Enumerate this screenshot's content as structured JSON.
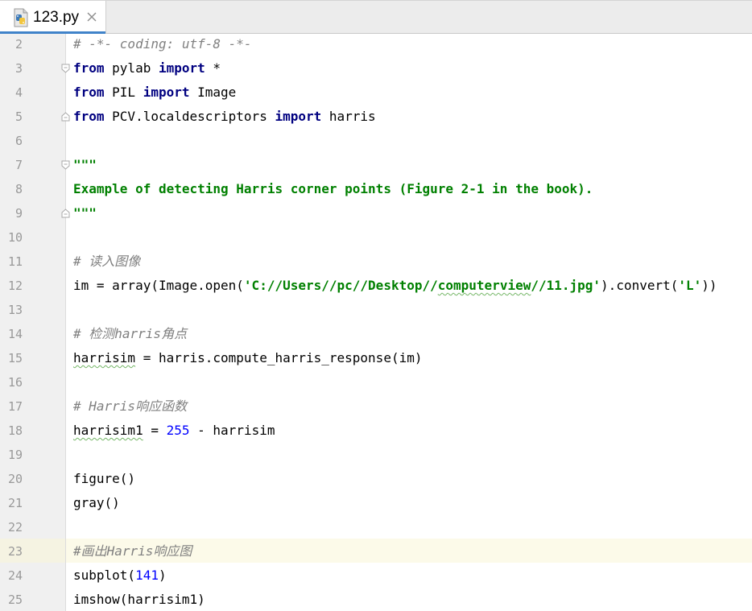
{
  "tab": {
    "title": "123.py",
    "icon": "python-file-icon",
    "close_icon": "close-icon"
  },
  "colors": {
    "keyword": "#000080",
    "comment": "#808080",
    "docstring": "#008000",
    "number": "#0000ff",
    "caret_row": "#fcfae9",
    "tab_underline": "#4083c9"
  },
  "lines": [
    {
      "num": "2",
      "tokens": [
        {
          "t": "# -*- coding: utf-8 -*-",
          "c": "cm"
        }
      ]
    },
    {
      "num": "3",
      "tokens": [
        {
          "t": "from",
          "c": "kw"
        },
        {
          "t": " pylab ",
          "c": ""
        },
        {
          "t": "import",
          "c": "kw"
        },
        {
          "t": " *",
          "c": ""
        }
      ]
    },
    {
      "num": "4",
      "tokens": [
        {
          "t": "from",
          "c": "kw"
        },
        {
          "t": " PIL ",
          "c": ""
        },
        {
          "t": "import",
          "c": "kw"
        },
        {
          "t": " Image",
          "c": ""
        }
      ]
    },
    {
      "num": "5",
      "tokens": [
        {
          "t": "from",
          "c": "kw"
        },
        {
          "t": " PCV.localdescriptors ",
          "c": ""
        },
        {
          "t": "import",
          "c": "kw"
        },
        {
          "t": " harris",
          "c": ""
        }
      ]
    },
    {
      "num": "6",
      "tokens": []
    },
    {
      "num": "7",
      "tokens": [
        {
          "t": "\"\"\"",
          "c": "ds"
        }
      ]
    },
    {
      "num": "8",
      "tokens": [
        {
          "t": "Example of detecting Harris corner points (Figure 2-1 in the book).",
          "c": "ds"
        }
      ]
    },
    {
      "num": "9",
      "tokens": [
        {
          "t": "\"\"\"",
          "c": "ds"
        }
      ]
    },
    {
      "num": "10",
      "tokens": []
    },
    {
      "num": "11",
      "tokens": [
        {
          "t": "# 读入图像",
          "c": "cm"
        }
      ]
    },
    {
      "num": "12",
      "tokens": [
        {
          "t": "im = array(Image.open(",
          "c": ""
        },
        {
          "t": "'C://Users//pc//Desktop//",
          "c": "str"
        },
        {
          "t": "computerview",
          "c": "str spell"
        },
        {
          "t": "//11.jpg'",
          "c": "str"
        },
        {
          "t": ").convert(",
          "c": ""
        },
        {
          "t": "'L'",
          "c": "str"
        },
        {
          "t": "))",
          "c": ""
        }
      ]
    },
    {
      "num": "13",
      "tokens": []
    },
    {
      "num": "14",
      "tokens": [
        {
          "t": "# 检测harris角点",
          "c": "cm"
        }
      ]
    },
    {
      "num": "15",
      "tokens": [
        {
          "t": "harrisim",
          "c": "spell"
        },
        {
          "t": " = harris.compute_harris_response(im)",
          "c": ""
        }
      ]
    },
    {
      "num": "16",
      "tokens": []
    },
    {
      "num": "17",
      "tokens": [
        {
          "t": "# Harris响应函数",
          "c": "cm"
        }
      ]
    },
    {
      "num": "18",
      "tokens": [
        {
          "t": "harrisim1",
          "c": "spell"
        },
        {
          "t": " = ",
          "c": ""
        },
        {
          "t": "255",
          "c": "num"
        },
        {
          "t": " - harrisim",
          "c": ""
        }
      ]
    },
    {
      "num": "19",
      "tokens": []
    },
    {
      "num": "20",
      "tokens": [
        {
          "t": "figure()",
          "c": ""
        }
      ]
    },
    {
      "num": "21",
      "tokens": [
        {
          "t": "gray()",
          "c": ""
        }
      ]
    },
    {
      "num": "22",
      "tokens": []
    },
    {
      "num": "23",
      "tokens": [
        {
          "t": "#画出Harris响应图",
          "c": "cm"
        }
      ]
    },
    {
      "num": "24",
      "tokens": [
        {
          "t": "subplot(",
          "c": ""
        },
        {
          "t": "141",
          "c": "num"
        },
        {
          "t": ")",
          "c": ""
        }
      ]
    },
    {
      "num": "25",
      "tokens": [
        {
          "t": "imshow(harrisim1)",
          "c": ""
        }
      ]
    }
  ],
  "fold_markers": [
    {
      "line": "3",
      "kind": "fold-start-icon"
    },
    {
      "line": "5",
      "kind": "fold-end-icon"
    },
    {
      "line": "7",
      "kind": "fold-start-icon"
    },
    {
      "line": "9",
      "kind": "fold-end-icon"
    }
  ],
  "caret_line": "23"
}
